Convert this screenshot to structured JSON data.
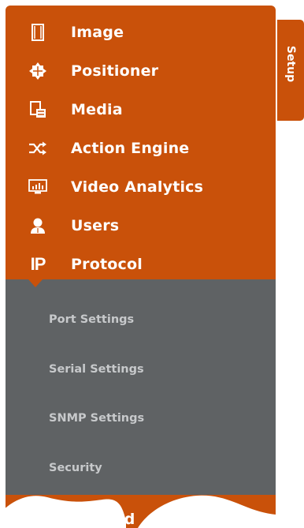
{
  "menu": {
    "items": [
      {
        "label": "Image",
        "icon": "film-frame-icon"
      },
      {
        "label": "Positioner",
        "icon": "positioner-icon"
      },
      {
        "label": "Media",
        "icon": "media-icon"
      },
      {
        "label": "Action Engine",
        "icon": "shuffle-icon"
      },
      {
        "label": "Video Analytics",
        "icon": "analytics-monitor-icon"
      },
      {
        "label": "Users",
        "icon": "user-icon"
      },
      {
        "label": "Protocol",
        "icon": "ip-icon",
        "icon_text": "IP"
      }
    ],
    "submenu": [
      {
        "label": "Port Settings"
      },
      {
        "label": "Serial Settings"
      },
      {
        "label": "SNMP Settings"
      },
      {
        "label": "Security"
      }
    ],
    "partial_item": {
      "label": "ate and"
    }
  },
  "setup_tab": {
    "label": "Setup"
  },
  "colors": {
    "accent": "#c9510a",
    "submenu_bg": "#5f6264",
    "submenu_text": "#c7c9cb"
  }
}
